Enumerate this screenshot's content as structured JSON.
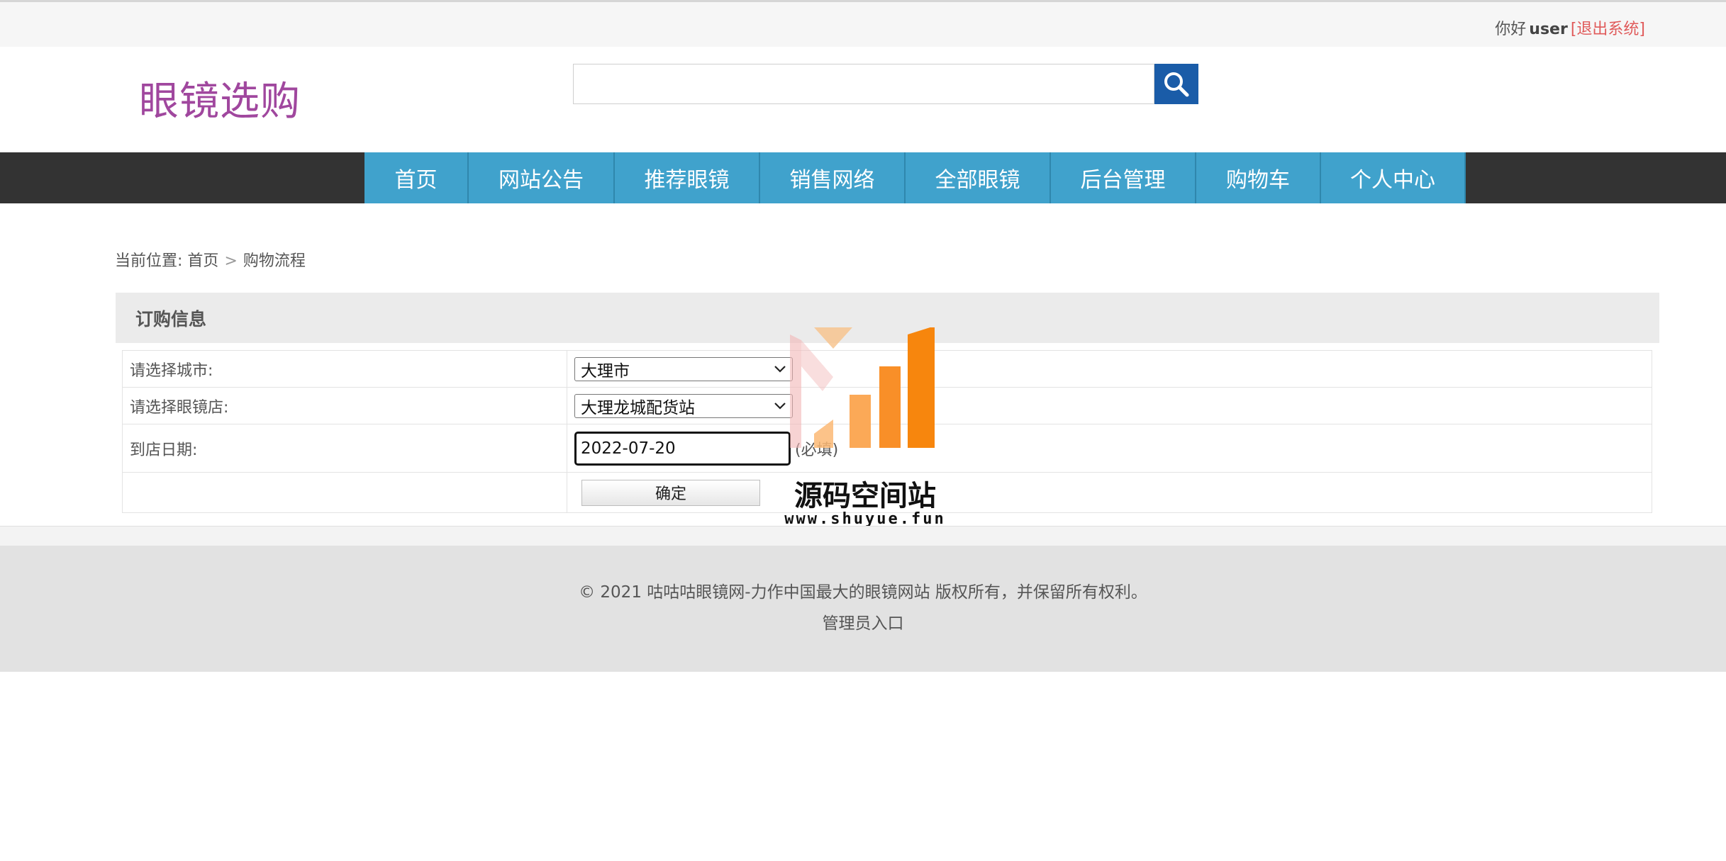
{
  "header": {
    "greeting": "你好",
    "username": "user",
    "logout_label": "[退出系统]",
    "logo": "眼镜选购",
    "search": {
      "value": "",
      "placeholder": ""
    }
  },
  "nav": {
    "items": [
      {
        "label": "首页"
      },
      {
        "label": "网站公告"
      },
      {
        "label": "推荐眼镜"
      },
      {
        "label": "销售网络"
      },
      {
        "label": "全部眼镜"
      },
      {
        "label": "后台管理"
      },
      {
        "label": "购物车"
      },
      {
        "label": "个人中心"
      }
    ]
  },
  "breadcrumb": {
    "prefix": "当前位置:",
    "home": "首页",
    "separator": ">",
    "current": "购物流程"
  },
  "order": {
    "title": "订购信息",
    "city_label": "请选择城市:",
    "city_value": "大理市",
    "store_label": "请选择眼镜店:",
    "store_value": "大理龙城配货站",
    "date_label": "到店日期:",
    "date_value": "2022-07-20",
    "required_note": "(必填)",
    "submit_label": "确定"
  },
  "footer": {
    "copyright": "© 2021 咕咕咕眼镜网-力作中国最大的眼镜网站 版权所有，并保留所有权利。",
    "admin_link": "管理员入口"
  },
  "watermark": {
    "title": "源码空间站",
    "url": "www.shuyue.fun"
  },
  "colors": {
    "nav_bg": "#40a2cc",
    "navbar_dark": "#333333",
    "logo": "#a0479e",
    "search_button": "#1a5ca8",
    "logout": "#e05a5a"
  },
  "icons": {
    "search": "search-icon",
    "select_arrow": "chevron-down-icon"
  }
}
